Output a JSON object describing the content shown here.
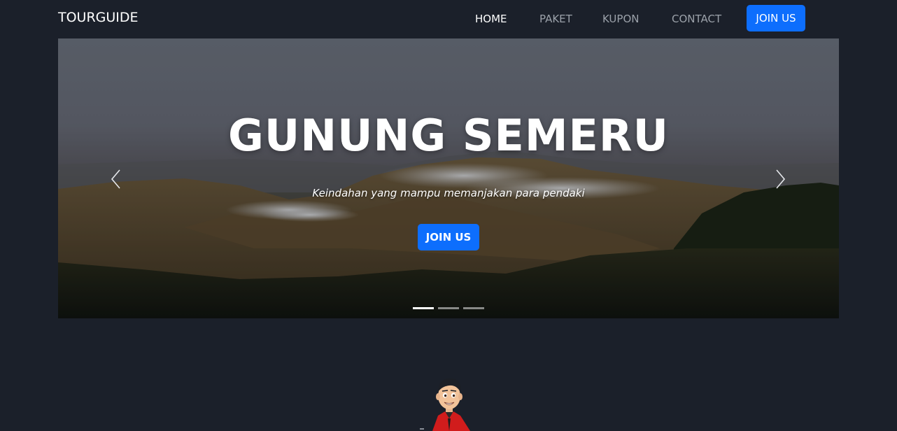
{
  "navbar": {
    "brand": "TOURGUIDE",
    "links": [
      {
        "label": "HOME",
        "active": true
      },
      {
        "label": "PAKET",
        "active": false
      },
      {
        "label": "KUPON",
        "active": false
      },
      {
        "label": "CONTACT",
        "active": false
      }
    ],
    "join_label": "JOIN US"
  },
  "hero": {
    "title": "GUNUNG SEMERU",
    "subtitle": "Keindahan yang mampu memanjakan para pendaki",
    "button_label": "JOIN US",
    "slide_count": 3,
    "active_slide": 1,
    "prev_icon": "chevron-left-icon",
    "next_icon": "chevron-right-icon"
  },
  "colors": {
    "page_bg": "#1b202a",
    "primary": "#0d6efd",
    "nav_inactive": "#9ba1a9",
    "nav_active": "#ffffff"
  }
}
